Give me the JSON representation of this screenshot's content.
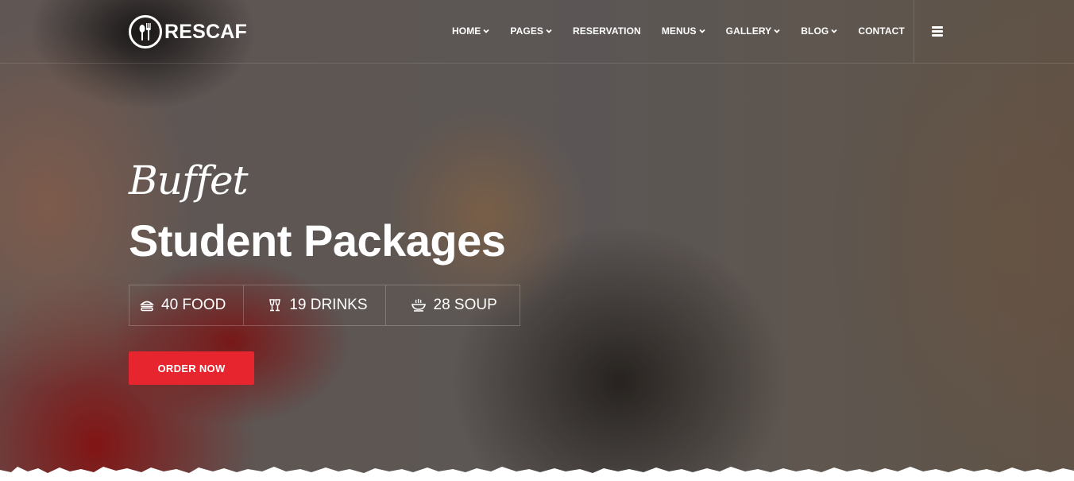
{
  "brand": {
    "name": "RESCAF"
  },
  "nav": {
    "items": [
      {
        "label": "HOME",
        "dropdown": true
      },
      {
        "label": "PAGES",
        "dropdown": true
      },
      {
        "label": "RESERVATION",
        "dropdown": false
      },
      {
        "label": "MENUS",
        "dropdown": true
      },
      {
        "label": "GALLERY",
        "dropdown": true
      },
      {
        "label": "BLOG",
        "dropdown": true
      },
      {
        "label": "CONTACT",
        "dropdown": false
      }
    ],
    "menu_icon": "hamburger-icon"
  },
  "hero": {
    "script_title": "Buffet",
    "title": "Student Packages",
    "features": [
      {
        "icon": "burger-icon",
        "label": "40 FOOD"
      },
      {
        "icon": "drinks-icon",
        "label": "19 DRINKS"
      },
      {
        "icon": "soup-icon",
        "label": "28 SOUP"
      }
    ],
    "cta_label": "ORDER NOW"
  },
  "colors": {
    "accent": "#e7252e",
    "text": "#ffffff"
  }
}
